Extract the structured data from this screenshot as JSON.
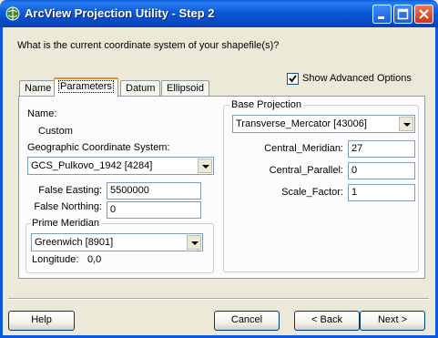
{
  "window": {
    "title": "ArcView Projection Utility - Step 2",
    "icon": "globe-icon"
  },
  "prompt": "What is the current coordinate system of your shapefile(s)?",
  "advanced_options": {
    "label": "Show Advanced Options",
    "checked": true
  },
  "tabs": [
    {
      "label": "Name",
      "active": false
    },
    {
      "label": "Parameters",
      "active": true
    },
    {
      "label": "Datum",
      "active": false
    },
    {
      "label": "Ellipsoid",
      "active": false
    }
  ],
  "parameters": {
    "name_label": "Name:",
    "name_value": "Custom",
    "gcs_label": "Geographic Coordinate System:",
    "gcs_value": "GCS_Pulkovo_1942 [4284]",
    "false_easting_label": "False Easting:",
    "false_easting_value": "5500000",
    "false_northing_label": "False Northing:",
    "false_northing_value": "0",
    "prime_meridian": {
      "group_label": "Prime Meridian",
      "value": "Greenwich [8901]",
      "longitude_label": "Longitude:",
      "longitude_value": "0,0"
    },
    "base_projection": {
      "group_label": "Base Projection",
      "value": "Transverse_Mercator [43006]",
      "central_meridian_label": "Central_Meridian:",
      "central_meridian_value": "27",
      "central_parallel_label": "Central_Parallel:",
      "central_parallel_value": "0",
      "scale_factor_label": "Scale_Factor:",
      "scale_factor_value": "1"
    }
  },
  "buttons": {
    "help": "Help",
    "cancel": "Cancel",
    "back": "< Back",
    "next": "Next >"
  }
}
